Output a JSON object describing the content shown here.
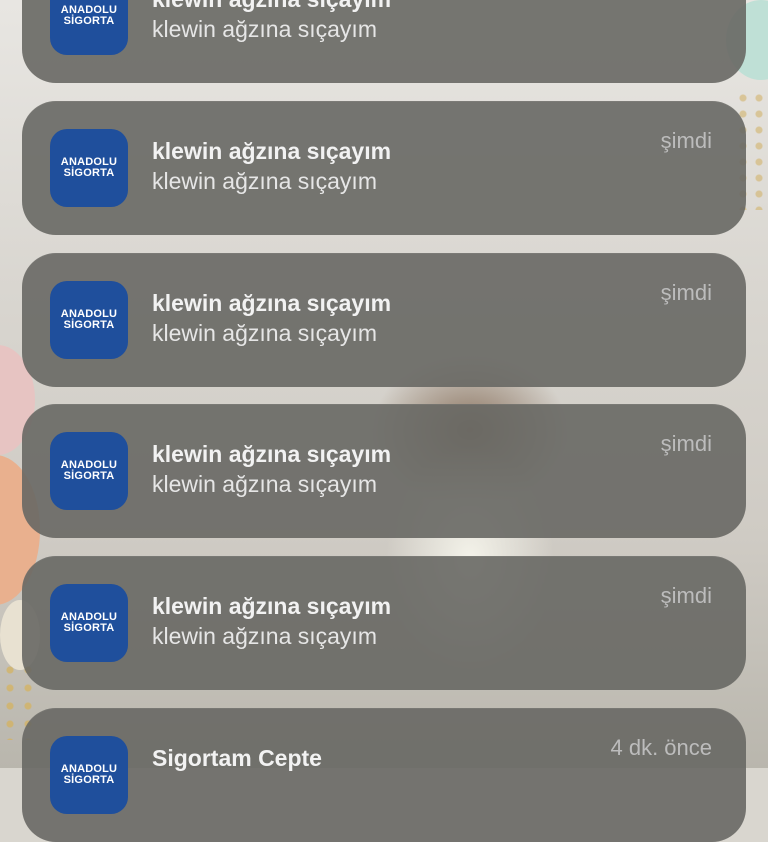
{
  "app_icon": {
    "name": "anadolu-sigorta-icon",
    "line1": "ANADOLU",
    "line2": "SİGORTA",
    "color": "#1f4f9c"
  },
  "notifications": [
    {
      "title": "klewin ağzına sıçayım",
      "body": "klewin ağzına sıçayım",
      "time": ""
    },
    {
      "title": "klewin ağzına sıçayım",
      "body": "klewin ağzına sıçayım",
      "time": "şimdi"
    },
    {
      "title": "klewin ağzına sıçayım",
      "body": "klewin ağzına sıçayım",
      "time": "şimdi"
    },
    {
      "title": "klewin ağzına sıçayım",
      "body": "klewin ağzına sıçayım",
      "time": "şimdi"
    },
    {
      "title": "klewin ağzına sıçayım",
      "body": "klewin ağzına sıçayım",
      "time": "şimdi"
    },
    {
      "title": "Sigortam Cepte",
      "body": "",
      "time": "4 dk. önce"
    }
  ]
}
